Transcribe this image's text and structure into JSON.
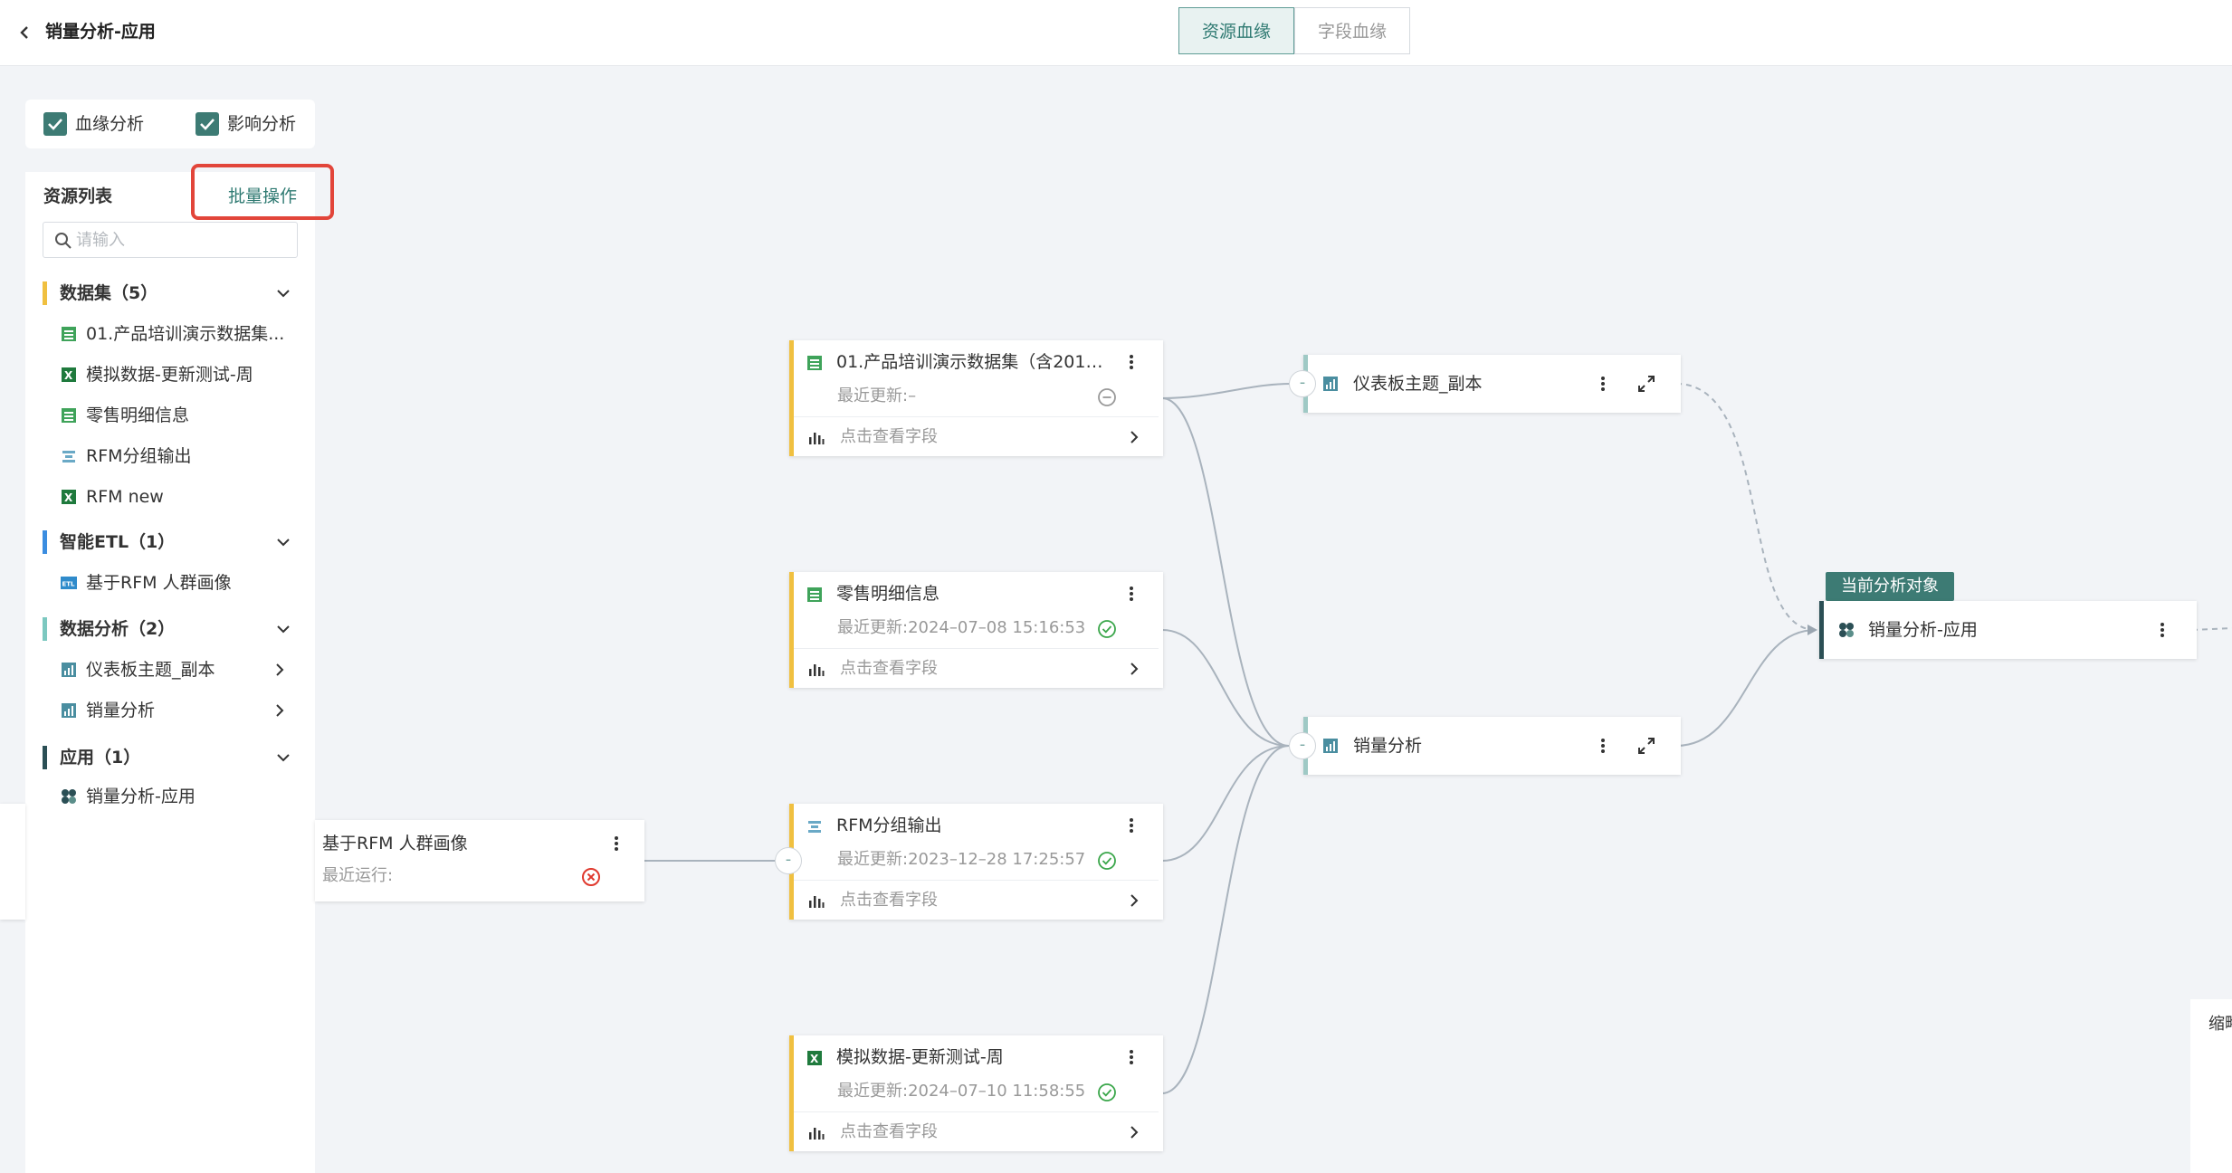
{
  "header": {
    "title": "销量分析-应用",
    "tabs": [
      {
        "label": "资源血缘",
        "active": true
      },
      {
        "label": "字段血缘",
        "active": false
      }
    ]
  },
  "checks": [
    {
      "label": "血缘分析",
      "checked": true
    },
    {
      "label": "影响分析",
      "checked": true
    }
  ],
  "sidebar": {
    "title": "资源列表",
    "batch_label": "批量操作",
    "search_placeholder": "请输入",
    "groups": [
      {
        "label": "数据集（5）",
        "color": "#f0c040",
        "items": [
          {
            "label": "01.产品培训演示数据集...",
            "icon": "dataset-table-icon"
          },
          {
            "label": "模拟数据-更新测试-周",
            "icon": "excel-icon"
          },
          {
            "label": "零售明细信息",
            "icon": "dataset-table-icon"
          },
          {
            "label": "RFM分组输出",
            "icon": "etl-output-icon"
          },
          {
            "label": "RFM new",
            "icon": "excel-icon"
          }
        ]
      },
      {
        "label": "智能ETL（1）",
        "color": "#3b8de0",
        "items": [
          {
            "label": "基于RFM 人群画像",
            "icon": "etl-icon"
          }
        ]
      },
      {
        "label": "数据分析（2）",
        "color": "#7cc8c0",
        "items": [
          {
            "label": "仪表板主题_副本",
            "icon": "dashboard-icon"
          },
          {
            "label": "销量分析",
            "icon": "dashboard-icon"
          }
        ]
      },
      {
        "label": "应用（1）",
        "color": "#2b4f55",
        "items": [
          {
            "label": "销量分析-应用",
            "icon": "app-icon"
          }
        ]
      }
    ]
  },
  "graph": {
    "current_tag": "当前分析对象",
    "field_link_label": "点击查看字段",
    "nodes": {
      "ds1": {
        "title": "01.产品培训演示数据集（含2019...",
        "sub": "最近更新:–",
        "status": "neutral"
      },
      "ds2": {
        "title": "零售明细信息",
        "sub": "最近更新:2024–07–08 15:16:53",
        "status": "ok"
      },
      "ds3": {
        "title": "RFM分组输出",
        "sub": "最近更新:2023–12–28 17:25:57",
        "status": "ok"
      },
      "ds4": {
        "title": "模拟数据-更新测试-周",
        "sub": "最近更新:2024–07–10 11:58:55",
        "status": "ok"
      },
      "etl": {
        "title": "基于RFM 人群画像",
        "sub": "最近运行:",
        "status": "error"
      },
      "dash1": {
        "title": "仪表板主题_副本"
      },
      "dash2": {
        "title": "销量分析"
      },
      "app": {
        "title": "销量分析-应用"
      }
    },
    "colors": {
      "ok": "#3aa64a",
      "error": "#e0392e",
      "accent": "#2f7a72",
      "edge": "#a9b3bd"
    }
  },
  "thumb_panel": {
    "label": "缩略"
  }
}
